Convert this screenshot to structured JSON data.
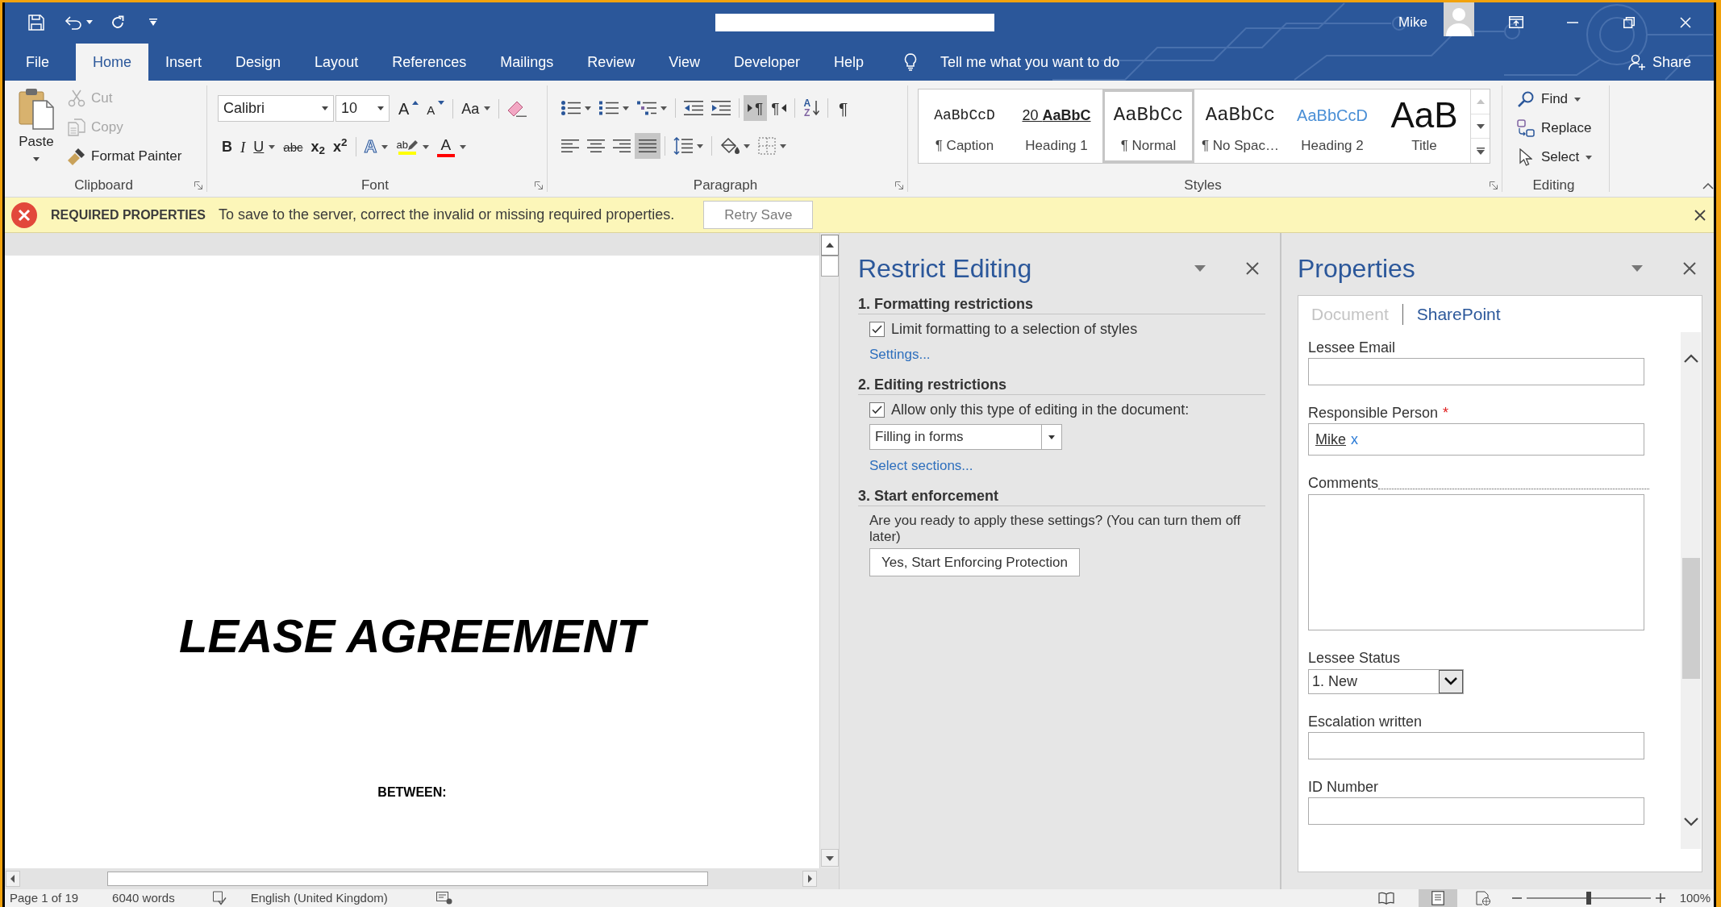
{
  "title_bar": {
    "user_name": "Mike"
  },
  "ribbon_tabs": [
    {
      "label": "File",
      "selected": false
    },
    {
      "label": "Home",
      "selected": true
    },
    {
      "label": "Insert",
      "selected": false
    },
    {
      "label": "Design",
      "selected": false
    },
    {
      "label": "Layout",
      "selected": false
    },
    {
      "label": "References",
      "selected": false
    },
    {
      "label": "Mailings",
      "selected": false
    },
    {
      "label": "Review",
      "selected": false
    },
    {
      "label": "View",
      "selected": false
    },
    {
      "label": "Developer",
      "selected": false
    },
    {
      "label": "Help",
      "selected": false
    }
  ],
  "tell_me": {
    "placeholder": "Tell me what you want to do"
  },
  "share_button": {
    "label": "Share"
  },
  "ribbon": {
    "clipboard": {
      "group_label": "Clipboard",
      "paste": {
        "label": "Paste"
      },
      "commands": [
        {
          "kind": "cut",
          "label": "Cut",
          "disabled": true
        },
        {
          "kind": "copy",
          "label": "Copy",
          "disabled": true
        },
        {
          "kind": "format-painter",
          "label": "Format Painter",
          "disabled": false
        }
      ]
    },
    "font": {
      "group_label": "Font",
      "font_name": "Calibri",
      "font_size": "10",
      "row1_buttons": [
        {
          "kind": "grow",
          "glyph": "A"
        },
        {
          "kind": "shrink",
          "glyph": "A"
        },
        {
          "kind": "change-case",
          "glyph": "Aa"
        },
        {
          "kind": "clear-formatting"
        }
      ],
      "row2_buttons": [
        {
          "kind": "bold",
          "glyph": "B"
        },
        {
          "kind": "italic",
          "glyph": "I"
        },
        {
          "kind": "underline",
          "glyph": "U"
        },
        {
          "kind": "strikethrough",
          "glyph": "abc"
        },
        {
          "kind": "subscript",
          "glyph": "x$_{2}$"
        },
        {
          "kind": "superscript",
          "glyph": "x$^{2}$"
        },
        {
          "kind": "text-effects",
          "glyph": "A"
        },
        {
          "kind": "highlight",
          "glyph": "ab",
          "color": "#ffff00"
        },
        {
          "kind": "font-color",
          "glyph": "A",
          "color": "#ff0000"
        }
      ]
    },
    "paragraph": {
      "group_label": "Paragraph",
      "rows": [
        [
          {
            "kind": "bullets",
            "selected": false
          },
          {
            "kind": "numbering",
            "selected": false
          },
          {
            "kind": "multilevel",
            "selected": false
          },
          {
            "kind": "decrease-indent",
            "selected": false
          },
          {
            "kind": "increase-indent",
            "selected": false
          },
          {
            "kind": "left-to-right",
            "glyph": "¶",
            "selected": true
          },
          {
            "kind": "right-to-left",
            "glyph": "¶",
            "selected": false
          },
          {
            "kind": "sort",
            "glyphs": [
              "A",
              "Z"
            ],
            "selected": false
          },
          {
            "kind": "show-marks",
            "glyph": "¶",
            "selected": false
          }
        ],
        [
          {
            "kind": "align-left",
            "selected": false
          },
          {
            "kind": "align-center",
            "selected": false
          },
          {
            "kind": "align-right",
            "selected": false
          },
          {
            "kind": "justify",
            "selected": true
          },
          {
            "kind": "line-spacing",
            "selected": false
          },
          {
            "kind": "shading",
            "selected": false
          },
          {
            "kind": "borders",
            "selected": false
          }
        ]
      ]
    },
    "styles": {
      "group_label": "Styles",
      "items": [
        {
          "kind": "caption",
          "preview": "AaBbCcD",
          "label": "¶ Caption",
          "selected": false
        },
        {
          "kind": "heading1",
          "preview": "20 **AaBbC**",
          "label": "Heading 1",
          "selected": false
        },
        {
          "kind": "normal",
          "preview": "AaBbCc",
          "label": "¶ Normal",
          "selected": true
        },
        {
          "kind": "no-spacing",
          "preview": "AaBbCc",
          "label": "¶ No Spac…",
          "selected": false
        },
        {
          "kind": "heading2",
          "preview": "AaBbCcD",
          "label": "Heading 2",
          "selected": false
        },
        {
          "kind": "title",
          "preview": "AaB",
          "label": "Title",
          "selected": false
        }
      ]
    },
    "editing": {
      "group_label": "Editing",
      "commands": [
        {
          "kind": "find",
          "label": "Find"
        },
        {
          "kind": "replace",
          "label": "Replace"
        },
        {
          "kind": "select",
          "label": "Select"
        }
      ]
    }
  },
  "message_bar": {
    "title": "REQUIRED PROPERTIES",
    "text": "To save to the server, correct the invalid or missing required properties.",
    "button": "Retry Save"
  },
  "document": {
    "title": "LEASE AGREEMENT",
    "subtitle": "BETWEEN:"
  },
  "restrict_editing": {
    "title": "Restrict Editing",
    "sections": [
      {
        "heading": "1. Formatting restrictions",
        "items": [
          {
            "kind": "checkbox",
            "label": "Limit formatting to a selection of styles",
            "checked": true
          },
          {
            "kind": "link",
            "label": "Settings..."
          }
        ]
      },
      {
        "heading": "2. Editing restrictions",
        "items": [
          {
            "kind": "checkbox",
            "label": "Allow only this type of editing in the document:",
            "checked": true
          },
          {
            "kind": "dropdown",
            "value": "Filling in forms"
          },
          {
            "kind": "link",
            "label": "Select sections..."
          }
        ]
      },
      {
        "heading": "3. Start enforcement",
        "items": [
          {
            "kind": "text",
            "text": "Are you ready to apply these settings? (You can turn them off later)"
          },
          {
            "kind": "button",
            "label": "Yes, Start Enforcing Protection"
          }
        ]
      }
    ]
  },
  "properties": {
    "title": "Properties",
    "tabs": [
      {
        "label": "Document",
        "selected": false
      },
      {
        "label": "SharePoint",
        "selected": true
      }
    ],
    "fields": [
      {
        "kind": "text",
        "label": "Lessee Email"
      },
      {
        "kind": "people",
        "label": "Responsible Person",
        "required_marker": "*",
        "value": "Mike",
        "remove": "x"
      },
      {
        "kind": "textarea",
        "label": "Comments"
      },
      {
        "kind": "select",
        "label": "Lessee Status",
        "value": "1. New"
      },
      {
        "kind": "text",
        "label": "Escalation written"
      },
      {
        "kind": "text",
        "label": "ID Number"
      }
    ]
  },
  "status_bar": {
    "page": "Page 1 of 19",
    "words": "6040 words",
    "language": "English (United Kingdom)",
    "views": [
      {
        "kind": "read",
        "selected": false
      },
      {
        "kind": "print",
        "selected": true
      },
      {
        "kind": "web",
        "selected": false
      }
    ],
    "zoom": {
      "level": 0.5,
      "reading": "100%"
    }
  }
}
